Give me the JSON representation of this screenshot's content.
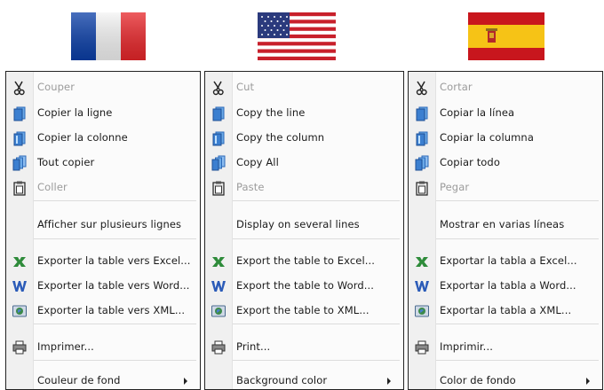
{
  "menus": [
    {
      "language": "French",
      "items": {
        "cut": "Couper",
        "copy_line": "Copier la ligne",
        "copy_column": "Copier la colonne",
        "copy_all": "Tout copier",
        "paste": "Coller",
        "multi_line": "Afficher sur plusieurs lignes",
        "export_excel": "Exporter la table vers Excel...",
        "export_word": "Exporter la table vers Word...",
        "export_xml": "Exporter la table vers XML...",
        "print": "Imprimer...",
        "background_color": "Couleur de fond"
      }
    },
    {
      "language": "English",
      "items": {
        "cut": "Cut",
        "copy_line": "Copy the line",
        "copy_column": "Copy the column",
        "copy_all": "Copy All",
        "paste": "Paste",
        "multi_line": "Display on several lines",
        "export_excel": "Export the table to Excel...",
        "export_word": "Export the table to Word...",
        "export_xml": "Export the table to XML...",
        "print": "Print...",
        "background_color": "Background color"
      }
    },
    {
      "language": "Spanish",
      "items": {
        "cut": "Cortar",
        "copy_line": "Copiar la línea",
        "copy_column": "Copiar la columna",
        "copy_all": "Copiar todo",
        "paste": "Pegar",
        "multi_line": "Mostrar en varias líneas",
        "export_excel": "Exportar la tabla a Excel...",
        "export_word": "Exportar la tabla a Word...",
        "export_xml": "Exportar la tabla a XML...",
        "print": "Imprimir...",
        "background_color": "Color de fondo"
      }
    }
  ],
  "disabled_items": [
    "cut",
    "paste"
  ],
  "icons": {
    "cut": "scissors-icon",
    "copy_line": "copy-line-icon",
    "copy_column": "copy-column-icon",
    "copy_all": "copy-all-icon",
    "paste": "clipboard-icon",
    "export_excel": "excel-icon",
    "export_word": "word-icon",
    "export_xml": "xml-icon",
    "print": "printer-icon"
  },
  "colors": {
    "excel_green": "#2e8b3a",
    "word_blue": "#2b5bb8",
    "copy_blue": "#3b7fd0",
    "disabled_text": "#9b9b9b"
  }
}
